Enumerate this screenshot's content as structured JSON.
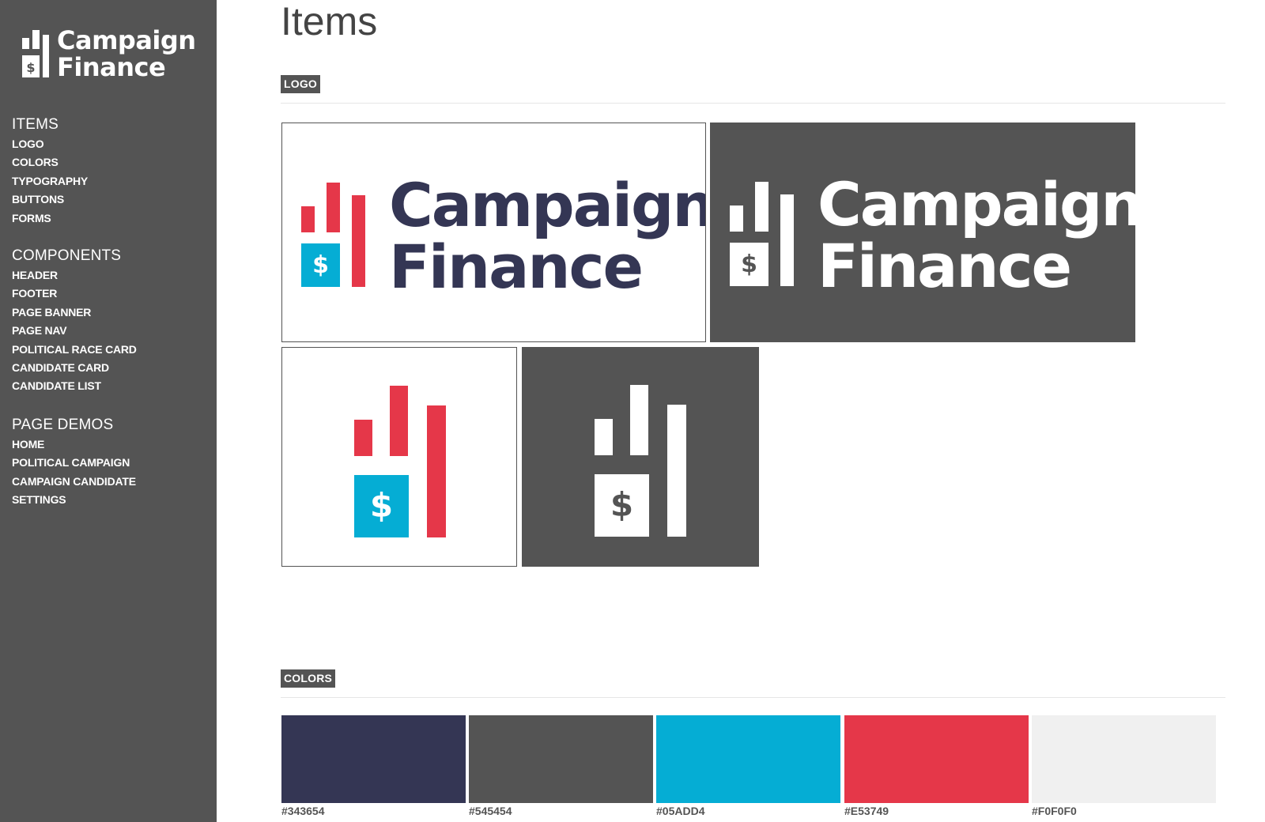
{
  "brand": {
    "line1": "Campaign",
    "line2": "Finance",
    "dollar": "$"
  },
  "sidebar": {
    "sections": [
      {
        "heading": "ITEMS",
        "items": [
          "LOGO",
          "COLORS",
          "TYPOGRAPHY",
          "BUTTONS",
          "FORMS"
        ]
      },
      {
        "heading": "COMPONENTS",
        "items": [
          "HEADER",
          "FOOTER",
          "PAGE BANNER",
          "PAGE NAV",
          "POLITICAL RACE CARD",
          "CANDIDATE CARD",
          "CANDIDATE LIST"
        ]
      },
      {
        "heading": "PAGE DEMOS",
        "items": [
          "HOME",
          "POLITICAL CAMPAIGN",
          "CAMPAIGN CANDIDATE",
          "SETTINGS"
        ]
      }
    ]
  },
  "main": {
    "title": "Items",
    "logo_section": {
      "tag": "LOGO"
    },
    "colors_section": {
      "tag": "COLORS",
      "swatches": [
        {
          "hex": "#343654",
          "label": "#343654"
        },
        {
          "hex": "#545454",
          "label": "#545454"
        },
        {
          "hex": "#05ADD4",
          "label": "#05ADD4"
        },
        {
          "hex": "#E53749",
          "label": "#E53749"
        },
        {
          "hex": "#F0F0F0",
          "label": "#F0F0F0"
        }
      ]
    }
  },
  "colors": {
    "navy": "#343654",
    "gray": "#545454",
    "cyan": "#05ADD4",
    "red": "#E53749",
    "light": "#F0F0F0"
  },
  "icons": {
    "logo_mark": "bar-chart-dollar-icon"
  }
}
